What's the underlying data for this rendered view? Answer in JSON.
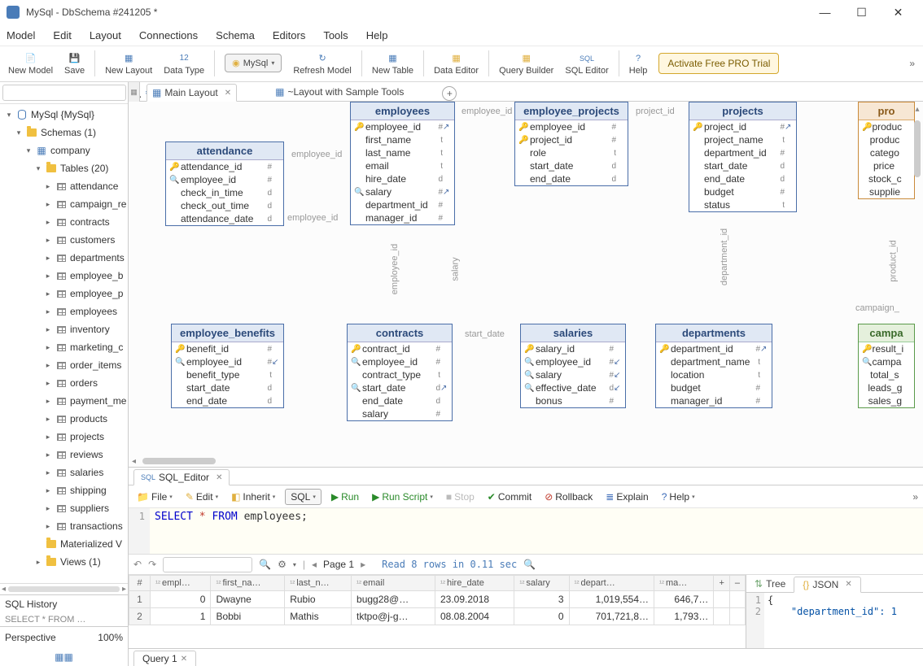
{
  "window": {
    "title": "MySql - DbSchema #241205 *"
  },
  "menu": {
    "model": "Model",
    "edit": "Edit",
    "layout": "Layout",
    "connections": "Connections",
    "schema": "Schema",
    "editors": "Editors",
    "tools": "Tools",
    "help": "Help"
  },
  "toolbar": {
    "newModel": "New Model",
    "save": "Save",
    "newLayout": "New Layout",
    "dataType": "Data Type",
    "mysql": "MySql",
    "refreshModel": "Refresh Model",
    "newTable": "New Table",
    "dataEditor": "Data Editor",
    "queryBuilder": "Query Builder",
    "sqlEditor": "SQL Editor",
    "help": "Help",
    "trial": "Activate Free PRO Trial"
  },
  "sidebar": {
    "root": "MySql {MySql}",
    "schemas": "Schemas (1)",
    "company": "company",
    "tablesGroup": "Tables (20)",
    "tables": [
      "attendance",
      "campaign_re",
      "contracts",
      "customers",
      "departments",
      "employee_b",
      "employee_p",
      "employees",
      "inventory",
      "marketing_c",
      "order_items",
      "orders",
      "payment_me",
      "products",
      "projects",
      "reviews",
      "salaries",
      "shipping",
      "suppliers",
      "transactions"
    ],
    "matViews": "Materialized V",
    "views": "Views (1)",
    "history": "SQL History",
    "historyItem": "SELECT * FROM …",
    "perspective": "Perspective",
    "perspectivePct": "100%"
  },
  "layoutTabs": {
    "main": "Main Layout",
    "sample": "~Layout with Sample Tools"
  },
  "diagram": {
    "attendance": {
      "title": "attendance",
      "cols": [
        {
          "k": "🔑",
          "n": "attendance_id",
          "t": "#"
        },
        {
          "k": "🔍",
          "n": "employee_id",
          "t": "#"
        },
        {
          "k": "",
          "n": "check_in_time",
          "t": "d"
        },
        {
          "k": "",
          "n": "check_out_time",
          "t": "d"
        },
        {
          "k": "",
          "n": "attendance_date",
          "t": "d"
        }
      ]
    },
    "employees": {
      "title": "employees",
      "cols": [
        {
          "k": "🔑",
          "n": "employee_id",
          "t": "#",
          "a": "↗"
        },
        {
          "k": "",
          "n": "first_name",
          "t": "t"
        },
        {
          "k": "",
          "n": "last_name",
          "t": "t"
        },
        {
          "k": "",
          "n": "email",
          "t": "t"
        },
        {
          "k": "",
          "n": "hire_date",
          "t": "d"
        },
        {
          "k": "🔍",
          "n": "salary",
          "t": "#",
          "a": "↗"
        },
        {
          "k": "",
          "n": "department_id",
          "t": "#"
        },
        {
          "k": "",
          "n": "manager_id",
          "t": "#"
        }
      ]
    },
    "employee_projects": {
      "title": "employee_projects",
      "cols": [
        {
          "k": "🔑",
          "n": "employee_id",
          "t": "#"
        },
        {
          "k": "🔑",
          "n": "project_id",
          "t": "#"
        },
        {
          "k": "",
          "n": "role",
          "t": "t"
        },
        {
          "k": "",
          "n": "start_date",
          "t": "d"
        },
        {
          "k": "",
          "n": "end_date",
          "t": "d"
        }
      ]
    },
    "projects": {
      "title": "projects",
      "cols": [
        {
          "k": "🔑",
          "n": "project_id",
          "t": "#",
          "a": "↗"
        },
        {
          "k": "",
          "n": "project_name",
          "t": "t"
        },
        {
          "k": "",
          "n": "department_id",
          "t": "#"
        },
        {
          "k": "",
          "n": "start_date",
          "t": "d"
        },
        {
          "k": "",
          "n": "end_date",
          "t": "d"
        },
        {
          "k": "",
          "n": "budget",
          "t": "#"
        },
        {
          "k": "",
          "n": "status",
          "t": "t"
        }
      ]
    },
    "employee_benefits": {
      "title": "employee_benefits",
      "cols": [
        {
          "k": "🔑",
          "n": "benefit_id",
          "t": "#"
        },
        {
          "k": "🔍",
          "n": "employee_id",
          "t": "#",
          "a": "↙"
        },
        {
          "k": "",
          "n": "benefit_type",
          "t": "t"
        },
        {
          "k": "",
          "n": "start_date",
          "t": "d"
        },
        {
          "k": "",
          "n": "end_date",
          "t": "d"
        }
      ]
    },
    "contracts": {
      "title": "contracts",
      "cols": [
        {
          "k": "🔑",
          "n": "contract_id",
          "t": "#"
        },
        {
          "k": "🔍",
          "n": "employee_id",
          "t": "#"
        },
        {
          "k": "",
          "n": "contract_type",
          "t": "t"
        },
        {
          "k": "🔍",
          "n": "start_date",
          "t": "d",
          "a": "↗"
        },
        {
          "k": "",
          "n": "end_date",
          "t": "d"
        },
        {
          "k": "",
          "n": "salary",
          "t": "#"
        }
      ]
    },
    "salaries": {
      "title": "salaries",
      "cols": [
        {
          "k": "🔑",
          "n": "salary_id",
          "t": "#"
        },
        {
          "k": "🔍",
          "n": "employee_id",
          "t": "#",
          "a": "↙"
        },
        {
          "k": "🔍",
          "n": "salary",
          "t": "#",
          "a": "↙"
        },
        {
          "k": "🔍",
          "n": "effective_date",
          "t": "d",
          "a": "↙"
        },
        {
          "k": "",
          "n": "bonus",
          "t": "#"
        }
      ]
    },
    "departments": {
      "title": "departments",
      "cols": [
        {
          "k": "🔑",
          "n": "department_id",
          "t": "#",
          "a": "↗"
        },
        {
          "k": "",
          "n": "department_name",
          "t": "t"
        },
        {
          "k": "",
          "n": "location",
          "t": "t"
        },
        {
          "k": "",
          "n": "budget",
          "t": "#"
        },
        {
          "k": "",
          "n": "manager_id",
          "t": "#"
        }
      ]
    },
    "products_right": {
      "title": "pro",
      "cols": [
        {
          "k": "🔑",
          "n": "produc",
          "t": ""
        },
        {
          "k": "",
          "n": "produc",
          "t": ""
        },
        {
          "k": "",
          "n": "catego",
          "t": ""
        },
        {
          "k": "",
          "n": "price",
          "t": ""
        },
        {
          "k": "",
          "n": "stock_c",
          "t": ""
        },
        {
          "k": "",
          "n": "supplie",
          "t": ""
        }
      ]
    },
    "campaign_right": {
      "title": "campa",
      "cols": [
        {
          "k": "🔑",
          "n": "result_i",
          "t": ""
        },
        {
          "k": "🔍",
          "n": "campa",
          "t": ""
        },
        {
          "k": "",
          "n": "total_s",
          "t": ""
        },
        {
          "k": "",
          "n": "leads_g",
          "t": ""
        },
        {
          "k": "",
          "n": "sales_g",
          "t": ""
        }
      ]
    },
    "labels": {
      "employee_id1": "employee_id",
      "employee_id2": "employee_id",
      "employee_id3": "employee_id",
      "project_id": "project_id",
      "department_id": "department_id",
      "start_date": "start_date",
      "salary": "salary",
      "product_id": "product_id",
      "campaign": "campaign_"
    }
  },
  "sqlEditor": {
    "tab": "SQL_Editor",
    "toolbar": {
      "file": "File",
      "edit": "Edit",
      "inherit": "Inherit",
      "sql": "SQL",
      "run": "Run",
      "runScript": "Run Script",
      "stop": "Stop",
      "commit": "Commit",
      "rollback": "Rollback",
      "explain": "Explain",
      "help": "Help"
    },
    "code": {
      "select": "SELECT",
      "star": "*",
      "from": "FROM",
      "table": "employees;"
    },
    "status": {
      "page": "Page 1",
      "readMsg": "Read 8 rows in 0.11 sec"
    },
    "columns": [
      "empl…",
      "first_na…",
      "last_n…",
      "email",
      "hire_date",
      "salary",
      "depart…",
      "ma…"
    ],
    "rows": [
      {
        "n": "1",
        "id": "0",
        "fn": "Dwayne",
        "ln": "Rubio",
        "em": "bugg28@…",
        "hd": "23.09.2018",
        "sa": "3",
        "dp": "1,019,554…",
        "mg": "646,7…"
      },
      {
        "n": "2",
        "id": "1",
        "fn": "Bobbi",
        "ln": "Mathis",
        "em": "tktpo@j-g…",
        "hd": "08.08.2004",
        "sa": "0",
        "dp": "701,721,8…",
        "mg": "1,793…"
      }
    ]
  },
  "jsonPane": {
    "treeTab": "Tree",
    "jsonTab": "JSON",
    "brace": "{",
    "keyline": "    \"department_id\": 1"
  },
  "queryTab": "Query 1"
}
